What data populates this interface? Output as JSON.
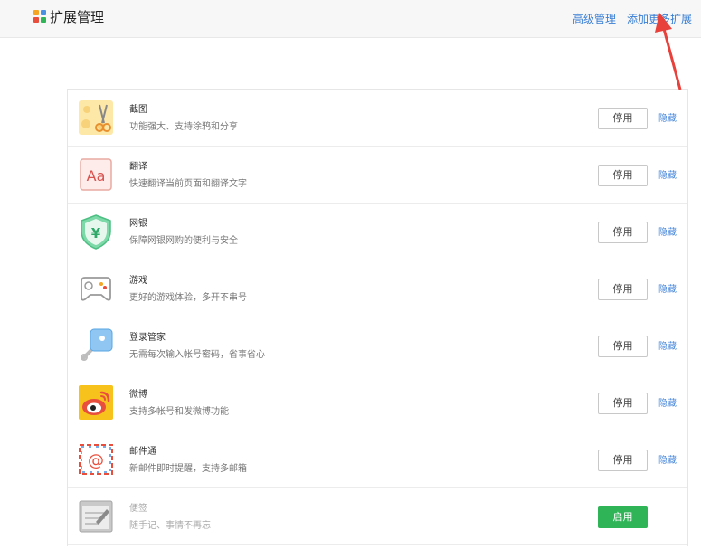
{
  "header": {
    "title": "扩展管理",
    "advanced_label": "高级管理",
    "add_more_label": "添加更多扩展"
  },
  "colors": {
    "link": "#3a7fd5",
    "enable_button": "#2fb457",
    "annotation_arrow": "#e8413b"
  },
  "extensions": [
    {
      "icon": "scissors-icon",
      "name": "截图",
      "desc": "功能强大、支持涂鸦和分享",
      "button": "停用",
      "hide": "隐藏"
    },
    {
      "icon": "translate-icon",
      "name": "翻译",
      "desc": "快速翻译当前页面和翻译文字",
      "button": "停用",
      "hide": "隐藏"
    },
    {
      "icon": "shield-yuan-icon",
      "name": "网银",
      "desc": "保障网银网购的便利与安全",
      "button": "停用",
      "hide": "隐藏"
    },
    {
      "icon": "gamepad-icon",
      "name": "游戏",
      "desc": "更好的游戏体验，多开不串号",
      "button": "停用",
      "hide": "隐藏"
    },
    {
      "icon": "key-icon",
      "name": "登录管家",
      "desc": "无需每次输入帐号密码，省事省心",
      "button": "停用",
      "hide": "隐藏"
    },
    {
      "icon": "weibo-icon",
      "name": "微博",
      "desc": "支持多帐号和发微博功能",
      "button": "停用",
      "hide": "隐藏"
    },
    {
      "icon": "mail-at-icon",
      "name": "邮件通",
      "desc": "新邮件即时提醒，支持多邮箱",
      "button": "停用",
      "hide": "隐藏"
    },
    {
      "icon": "note-icon",
      "name": "便签",
      "desc": "随手记、事情不再忘",
      "button": "启用"
    }
  ]
}
